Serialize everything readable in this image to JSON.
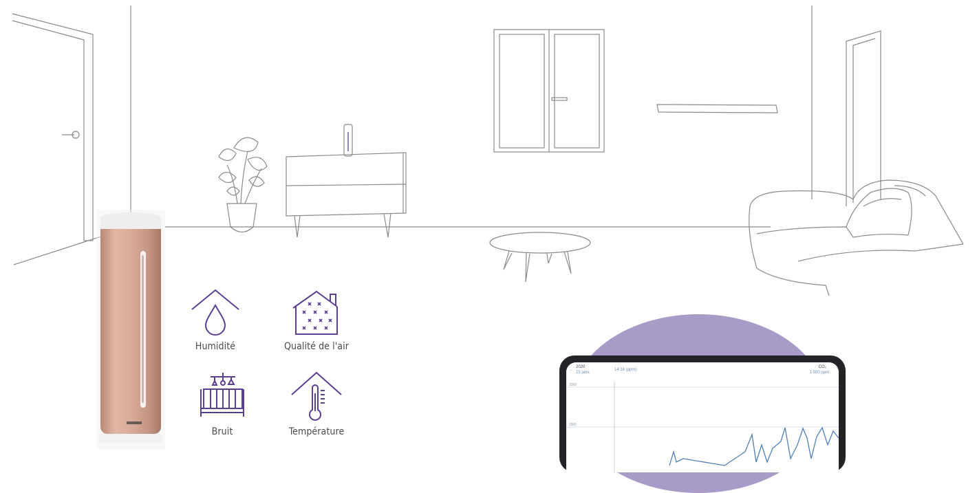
{
  "features": [
    {
      "label": "Humidité",
      "icon": "humidity-drop-icon"
    },
    {
      "label": "Qualité de l'air",
      "icon": "air-quality-house-icon"
    },
    {
      "label": "Bruit",
      "icon": "crib-mobile-icon"
    },
    {
      "label": "Température",
      "icon": "thermometer-house-icon"
    }
  ],
  "colors": {
    "icon_purple": "#5b3f8f",
    "blob_purple": "#a99bc7",
    "device_rose": "#d9ab9a",
    "line_gray": "#8a8a8a"
  },
  "phone_app": {
    "top_left_value": "2020",
    "top_left_sub": "15 janv.",
    "top_center": "14:18 (ppm)",
    "top_right_value": "CO₂",
    "top_right_sub": "1 000 ppm",
    "axis_labels": [
      "2000",
      "1500"
    ]
  }
}
